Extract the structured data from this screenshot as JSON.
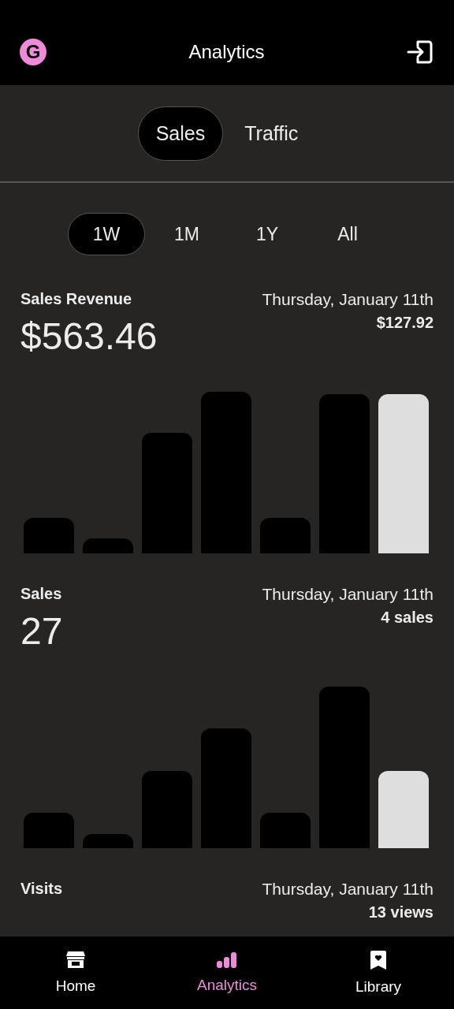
{
  "header": {
    "avatar": "G",
    "title": "Analytics"
  },
  "tabs": [
    {
      "label": "Sales",
      "selected": true
    },
    {
      "label": "Traffic",
      "selected": false
    }
  ],
  "ranges": [
    {
      "label": "1W",
      "selected": true
    },
    {
      "label": "1M",
      "selected": false
    },
    {
      "label": "1Y",
      "selected": false
    },
    {
      "label": "All",
      "selected": false
    }
  ],
  "metrics": [
    {
      "title": "Sales Revenue",
      "value": "$563.46",
      "date": "Thursday, January 11th",
      "detail": "$127.92",
      "bars": [
        {
          "selected": false
        },
        {
          "selected": false
        },
        {
          "selected": false
        },
        {
          "selected": false
        },
        {
          "selected": false
        },
        {
          "selected": false
        },
        {
          "selected": true
        }
      ]
    },
    {
      "title": "Sales",
      "value": "27",
      "date": "Thursday, January 11th",
      "detail": "4 sales",
      "bars": [
        {
          "selected": false
        },
        {
          "selected": false
        },
        {
          "selected": false
        },
        {
          "selected": false
        },
        {
          "selected": false
        },
        {
          "selected": false
        },
        {
          "selected": true
        }
      ]
    },
    {
      "title": "Visits",
      "date": "Thursday, January 11th",
      "detail": "13 views"
    }
  ],
  "nav": [
    {
      "label": "Home",
      "selected": false
    },
    {
      "label": "Analytics",
      "selected": true
    },
    {
      "label": "Library",
      "selected": false
    }
  ]
}
